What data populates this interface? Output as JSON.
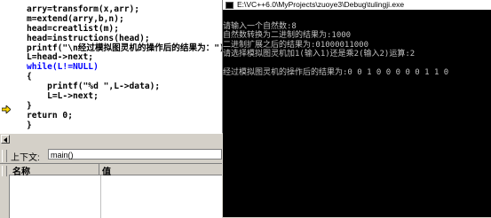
{
  "editor": {
    "lines": [
      "arry=transform(x,arr);",
      "m=extend(arry,b,n);",
      "head=creatlist(m);",
      "head=instructions(head);",
      "printf(\"\\n经过模拟图灵机的操作后的结果为：\");",
      "L=head->next;",
      "while(L!=NULL)",
      "{",
      "    printf(\"%d \",L->data);",
      "    L=L->next;",
      "}",
      "return 0;",
      "}"
    ]
  },
  "context_panel": {
    "label": "上下文:",
    "value": "main()",
    "columns": [
      "名称",
      "值"
    ]
  },
  "console": {
    "title": "E:\\VC++6.0\\MyProjects\\zuoye3\\Debug\\tulingji.exe",
    "lines": [
      "请输入一个自然数:8",
      "自然数转换为二进制的结果为:1000",
      "二进制扩展之后的结果为:01000011000",
      "请选择模拟图灵机加1(输入1)还是乘2(输入2)运算:2",
      "",
      "经过模拟图灵机的操作后的结果为:0 0 1 0 0 0 0 0 1 1 0"
    ]
  },
  "colors": {
    "keyword": "#0000ff",
    "console_bg": "#000000",
    "console_fg": "#c0c0c0",
    "arrow": "#ffd800"
  }
}
